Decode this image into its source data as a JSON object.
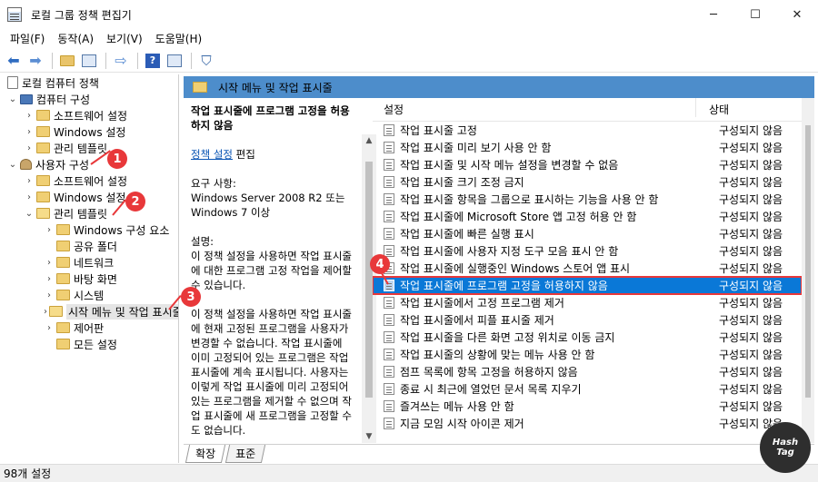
{
  "window": {
    "title": "로컬 그룹 정책 편집기",
    "controls": [
      "─",
      "☐",
      "✕"
    ]
  },
  "menu": [
    "파일(F)",
    "동작(A)",
    "보기(V)",
    "도움말(H)"
  ],
  "tree": [
    {
      "label": "로컬 컴퓨터 정책",
      "level": 0,
      "chevron": "",
      "icon": "doc"
    },
    {
      "label": "컴퓨터 구성",
      "level": 1,
      "chevron": "⌄",
      "icon": "pc"
    },
    {
      "label": "소프트웨어 설정",
      "level": 2,
      "chevron": "›",
      "icon": "folder"
    },
    {
      "label": "Windows 설정",
      "level": 2,
      "chevron": "›",
      "icon": "folder"
    },
    {
      "label": "관리 템플릿",
      "level": 2,
      "chevron": "›",
      "icon": "folder"
    },
    {
      "label": "사용자 구성",
      "level": 1,
      "chevron": "⌄",
      "icon": "user"
    },
    {
      "label": "소프트웨어 설정",
      "level": 2,
      "chevron": "›",
      "icon": "folder"
    },
    {
      "label": "Windows 설정",
      "level": 2,
      "chevron": "›",
      "icon": "folder"
    },
    {
      "label": "관리 템플릿",
      "level": 2,
      "chevron": "⌄",
      "icon": "open"
    },
    {
      "label": "Windows 구성 요소",
      "level": 3,
      "chevron": "›",
      "icon": "folder"
    },
    {
      "label": "공유 폴더",
      "level": 3,
      "chevron": "",
      "icon": "folder"
    },
    {
      "label": "네트워크",
      "level": 3,
      "chevron": "›",
      "icon": "folder"
    },
    {
      "label": "바탕 화면",
      "level": 3,
      "chevron": "›",
      "icon": "folder"
    },
    {
      "label": "시스템",
      "level": 3,
      "chevron": "›",
      "icon": "folder"
    },
    {
      "label": "시작 메뉴 및 작업 표시줄",
      "level": 3,
      "chevron": "›",
      "icon": "open",
      "selected": true
    },
    {
      "label": "제어판",
      "level": 3,
      "chevron": "›",
      "icon": "folder"
    },
    {
      "label": "모든 설정",
      "level": 3,
      "chevron": "",
      "icon": "folder"
    }
  ],
  "callouts": [
    "1",
    "2",
    "3",
    "4"
  ],
  "panel": {
    "title": "시작 메뉴 및 작업 표시줄"
  },
  "description": {
    "title": "작업 표시줄에 프로그램 고정을 허용하지 않음",
    "link": "정책 설정",
    "edit": "편집",
    "requirements_label": "요구 사항:",
    "requirements": "Windows Server 2008 R2 또는 Windows 7 이상",
    "desc_label": "설명:",
    "para1": "이 정책 설정을 사용하면 작업 표시줄에 대한 프로그램 고정 작업을 제어할 수 있습니다.",
    "para2": "이 정책 설정을 사용하면 작업 표시줄에 현재 고정된 프로그램을 사용자가 변경할 수 없습니다. 작업 표시줄에 이미 고정되어 있는 프로그램은 작업 표시줄에 계속 표시됩니다. 사용자는 이렇게 작업 표시줄에 미리 고정되어 있는 프로그램을 제거할 수 없으며 작업 표시줄에 새 프로그램을 고정할 수도 없습니다."
  },
  "list": {
    "col_setting": "설정",
    "col_state": "상태",
    "rows": [
      {
        "name": "작업 표시줄 고정",
        "state": "구성되지 않음"
      },
      {
        "name": "작업 표시줄 미리 보기 사용 안 함",
        "state": "구성되지 않음"
      },
      {
        "name": "작업 표시줄 및 시작 메뉴 설정을 변경할 수 없음",
        "state": "구성되지 않음"
      },
      {
        "name": "작업 표시줄 크기 조정 금지",
        "state": "구성되지 않음"
      },
      {
        "name": "작업 표시줄 항목을 그룹으로 표시하는 기능을 사용 안 함",
        "state": "구성되지 않음"
      },
      {
        "name": "작업 표시줄에 Microsoft Store 앱 고정 허용 안 함",
        "state": "구성되지 않음"
      },
      {
        "name": "작업 표시줄에 빠른 실행 표시",
        "state": "구성되지 않음"
      },
      {
        "name": "작업 표시줄에 사용자 지정 도구 모음 표시 안 함",
        "state": "구성되지 않음"
      },
      {
        "name": "작업 표시줄에 실행중인 Windows 스토어 앱 표시",
        "state": "구성되지 않음"
      },
      {
        "name": "작업 표시줄에 프로그램 고정을 허용하지 않음",
        "state": "구성되지 않음",
        "selected": true
      },
      {
        "name": "작업 표시줄에서 고정 프로그램 제거",
        "state": "구성되지 않음"
      },
      {
        "name": "작업 표시줄에서 피플 표시줄 제거",
        "state": "구성되지 않음"
      },
      {
        "name": "작업 표시줄을 다른 화면 고정 위치로 이동 금지",
        "state": "구성되지 않음"
      },
      {
        "name": "작업 표시줄의 상황에 맞는 메뉴 사용 안 함",
        "state": "구성되지 않음"
      },
      {
        "name": "점프 목록에 항목 고정을 허용하지 않음",
        "state": "구성되지 않음"
      },
      {
        "name": "종료 시 최근에 열었던 문서 목록 지우기",
        "state": "구성되지 않음"
      },
      {
        "name": "즐겨쓰는 메뉴 사용 안 함",
        "state": "구성되지 않음"
      },
      {
        "name": "지금 모임 시작 아이콘 제거",
        "state": "구성되지 않음"
      }
    ]
  },
  "tabs": [
    "확장",
    "표준"
  ],
  "status": "98개 설정",
  "watermark": [
    "Hash",
    "Tag"
  ]
}
